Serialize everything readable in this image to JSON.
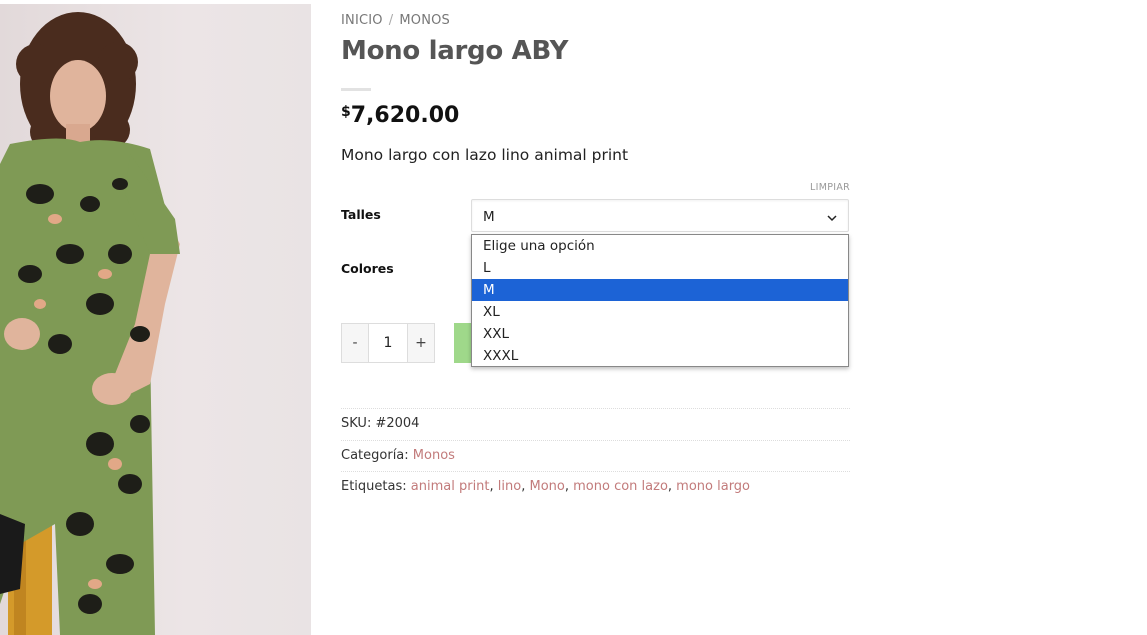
{
  "breadcrumb": {
    "home": "INICIO",
    "separator": "/",
    "category": "MONOS"
  },
  "product": {
    "title": "Mono largo ABY",
    "currency": "$",
    "price": "7,620.00",
    "short_description": "Mono largo con lazo lino animal print"
  },
  "variations": {
    "clear_label": "LIMPIAR",
    "sizes_label": "Talles",
    "colors_label": "Colores",
    "selected_size": "M",
    "size_options": [
      "Elige una opción",
      "L",
      "M",
      "XL",
      "XXL",
      "XXXL"
    ],
    "highlighted_index": 2
  },
  "quantity": {
    "minus": "-",
    "value": "1",
    "plus": "+"
  },
  "meta": {
    "sku_label": "SKU:",
    "sku_value": "#2004",
    "category_label": "Categoría:",
    "category_value": "Monos",
    "tags_label": "Etiquetas:",
    "tags": [
      "animal print",
      "lino",
      "Mono",
      "mono con lazo",
      "mono largo"
    ]
  },
  "colors": {
    "highlight": "#1c63d6",
    "link": "#c27b7b",
    "add_button": "#9fd88a"
  }
}
